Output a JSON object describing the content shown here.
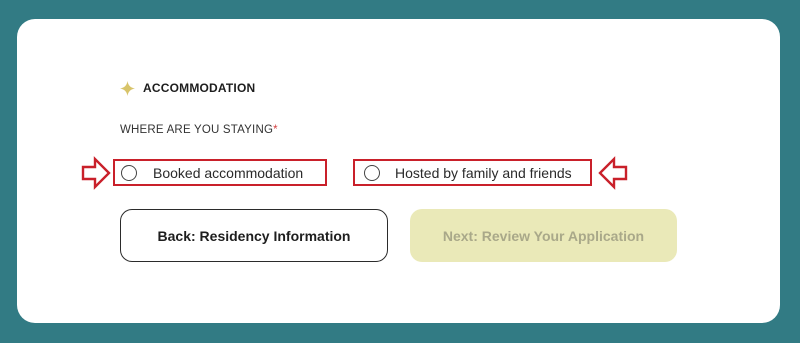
{
  "section": {
    "title": "ACCOMMODATION",
    "icon": "sparkle-icon",
    "icon_color": "#d8c46a"
  },
  "question": {
    "label": "WHERE ARE YOU STAYING",
    "required_marker": "*"
  },
  "options": [
    {
      "label": "Booked accommodation",
      "selected": false
    },
    {
      "label": "Hosted by family and friends",
      "selected": false
    }
  ],
  "buttons": {
    "back_label": "Back: Residency Information",
    "next_label": "Next: Review Your Application",
    "next_enabled": false
  },
  "colors": {
    "background": "#327b84",
    "card": "#ffffff",
    "highlight": "#c9202a",
    "next_button_bg": "#eae9b8",
    "next_button_text": "#a9a889"
  }
}
